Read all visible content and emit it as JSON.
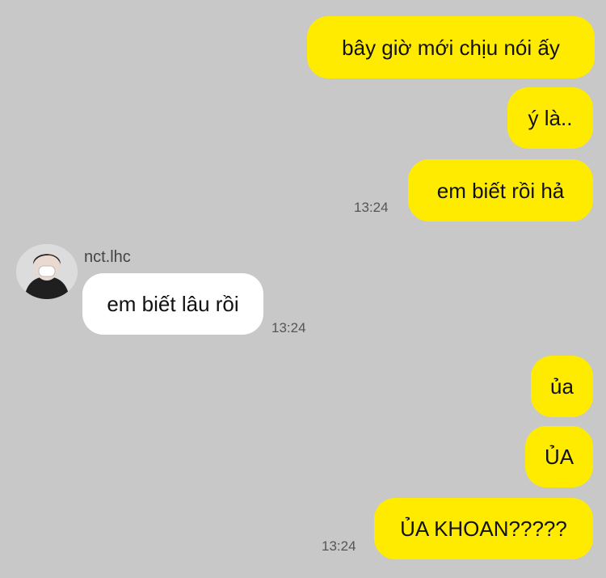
{
  "messages": [
    {
      "direction": "outgoing",
      "text": "bây giờ mới chịu nói ấy"
    },
    {
      "direction": "outgoing",
      "text": "ý là.."
    },
    {
      "direction": "outgoing",
      "text": "em biết rồi hả",
      "time": "13:24"
    },
    {
      "direction": "incoming",
      "sender": "nct.lhc",
      "text": "em biết lâu rồi",
      "time": "13:24",
      "avatar": "profile-photo"
    },
    {
      "direction": "outgoing",
      "text": "ủa"
    },
    {
      "direction": "outgoing",
      "text": "ỦA"
    },
    {
      "direction": "outgoing",
      "text": "ỦA KHOAN?????",
      "time": "13:24"
    }
  ],
  "colors": {
    "background": "#c8c8c8",
    "outgoing_bubble": "#ffeb00",
    "incoming_bubble": "#ffffff"
  }
}
